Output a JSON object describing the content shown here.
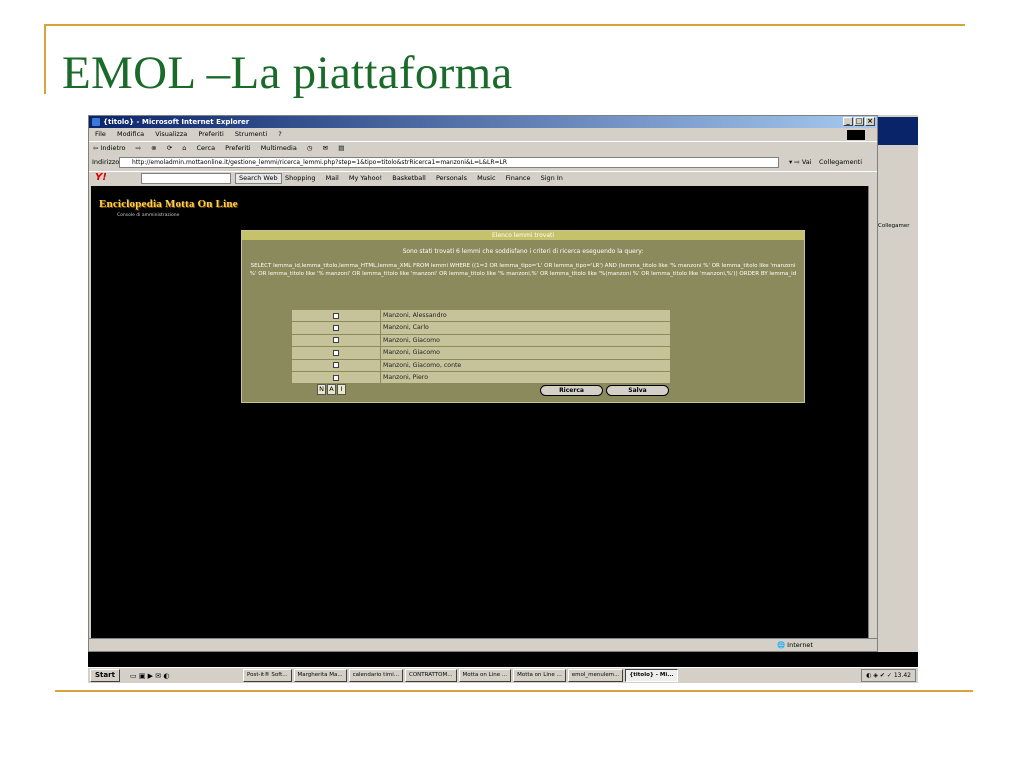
{
  "slide": {
    "title": "EMOL –La piattaforma"
  },
  "browser": {
    "window_title": "{titolo} - Microsoft Internet Explorer",
    "menu": [
      "File",
      "Modifica",
      "Visualizza",
      "Preferiti",
      "Strumenti",
      "?"
    ],
    "toolbar": [
      "⇦ Indietro",
      "⇨",
      "Cerca",
      "Preferiti",
      "Multimedia"
    ],
    "address_label": "Indirizzo",
    "address_url": "http://emoladmin.mottaonline.it/gestione_lemmi/ricerca_lemmi.php?step=1&tipo=titolo&strRicerca1=manzoni&L=L&LR=LR",
    "go_label": "Vai",
    "links_label": "Collegamenti",
    "yahoo": {
      "logo": "Y!",
      "search_button": "Search Web",
      "items": [
        "Shopping",
        "Mail",
        "My Yahoo!",
        "Basketball",
        "Personals",
        "Music",
        "Finance",
        "Sign In"
      ]
    }
  },
  "page": {
    "logo": "Enciclopedia Motta On Line",
    "logo_sub": "Console di amministrazione",
    "panel_title": "Elenco lemmi trovati",
    "message": "Sono stati trovati 6 lemmi che soddisfano i criteri di ricerca eseguendo la query:",
    "query": "SELECT lemma_id,lemma_titolo,lemma_HTML,lemma_XML FROM lemmi WHERE ((1=2 OR lemma_tipo='L' OR lemma_tipo='LR') AND (lemma_titolo like '% manzoni %' OR lemma_titolo like 'manzoni %' OR lemma_titolo like '% manzoni' OR lemma_titolo like 'manzoni' OR lemma_titolo like '% manzoni,%' OR lemma_titolo like '%(manzoni %' OR lemma_titolo like 'manzoni,%')) ORDER BY lemma_id",
    "results": [
      "Manzoni, Alessandro",
      "Manzoni, Carlo",
      "Manzoni, Giacomo",
      "Manzoni, Giacomo",
      "Manzoni, Giacomo, conte",
      "Manzoni, Piero"
    ],
    "nai_buttons": [
      "N",
      "A",
      "I"
    ],
    "search_button": "Ricerca",
    "save_button": "Salva"
  },
  "status": {
    "zone": "Internet"
  },
  "background_window": {
    "link": "Collegamer"
  },
  "taskbar": {
    "start": "Start",
    "tasks": [
      "Post-it® Soft...",
      "Margherita Ma...",
      "calendario timi...",
      "CONTRATTOM...",
      "Motta on Line ...",
      "Motta on Line ...",
      "emol_menulem...",
      "{titolo} - Mi..."
    ],
    "clock": "13.42"
  }
}
